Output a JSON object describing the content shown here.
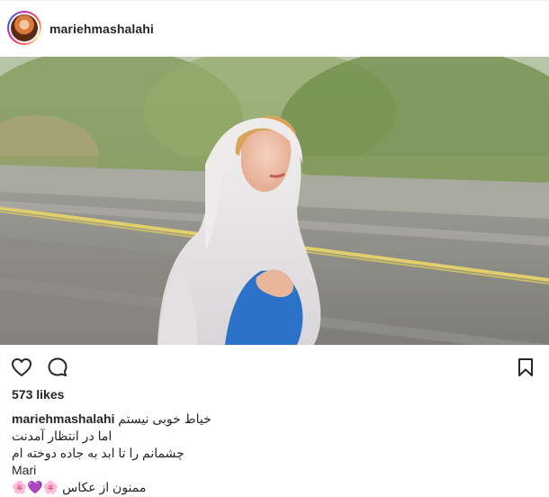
{
  "post": {
    "username": "mariehmashalahi",
    "likes_text": "573 likes",
    "caption": {
      "first_line": "خیاط خوبی نیستم",
      "lines": [
        "اما در انتظار آمدنت",
        "چشمانم را تا ابد به جاده دوخته ام",
        "Mari",
        "ممنون از عکاس 🌸💜🌸"
      ]
    }
  },
  "icons": {
    "like": "heart-outline-icon",
    "comment": "comment-bubble-icon",
    "save": "bookmark-icon"
  },
  "colors": {
    "text": "#262626",
    "story_ring_start": "#d6249f",
    "story_ring_end": "#285aeb"
  }
}
